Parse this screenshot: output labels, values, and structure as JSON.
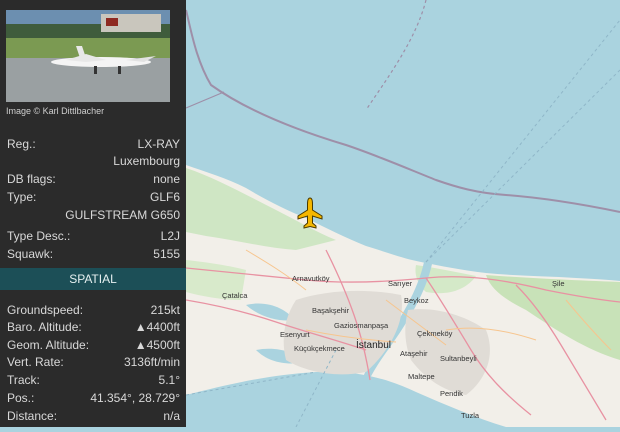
{
  "sidebar": {
    "photo_credit": "Image © Karl Dittlbacher",
    "info": {
      "reg_label": "Reg.:",
      "reg_value": "LX-RAY",
      "country": "Luxembourg",
      "dbflags_label": "DB flags:",
      "dbflags_value": "none",
      "type_label": "Type:",
      "type_value": "GLF6",
      "type_full": "GULFSTREAM G650",
      "typedesc_label": "Type Desc.:",
      "typedesc_value": "L2J",
      "squawk_label": "Squawk:",
      "squawk_value": "5155"
    },
    "spatial_header": "SPATIAL",
    "spatial": {
      "groundspeed_label": "Groundspeed:",
      "groundspeed_value": "215",
      "groundspeed_unit": "kt",
      "baro_label": "Baro. Altitude:",
      "baro_value": "▲4400",
      "baro_unit": "ft",
      "geom_label": "Geom. Altitude:",
      "geom_value": "▲4500",
      "geom_unit": "ft",
      "vrate_label": "Vert. Rate:",
      "vrate_value": "3136",
      "vrate_unit": "ft/min",
      "track_label": "Track:",
      "track_value": "5.1°",
      "pos_label": "Pos.:",
      "pos_value": "41.354°, 28.729°",
      "distance_label": "Distance:",
      "distance_value": "n/a"
    }
  },
  "map": {
    "aircraft_icon": "airplane-icon",
    "aircraft_color": "#f5b700",
    "sea_color": "#aad3df",
    "land_color": "#f2efe9",
    "towns": {
      "arnavutkoy": "Arnavutköy",
      "catalca": "Çatalca",
      "sariyer": "Sarıyer",
      "beykoz": "Beykoz",
      "sile": "Şile",
      "basaksehir": "Başakşehir",
      "gaziosmanpasa": "Gaziosmanpaşa",
      "esenyurt": "Esenyurt",
      "cekmekoy": "Çekmeköy",
      "istanbul": "İstanbul",
      "kucukcekmece": "Küçükçekmece",
      "atasehir": "Ataşehir",
      "sultanbeyli": "Sultanbeyli",
      "maltepe": "Maltepe",
      "pendik": "Pendik",
      "tuzla": "Tuzla"
    }
  }
}
